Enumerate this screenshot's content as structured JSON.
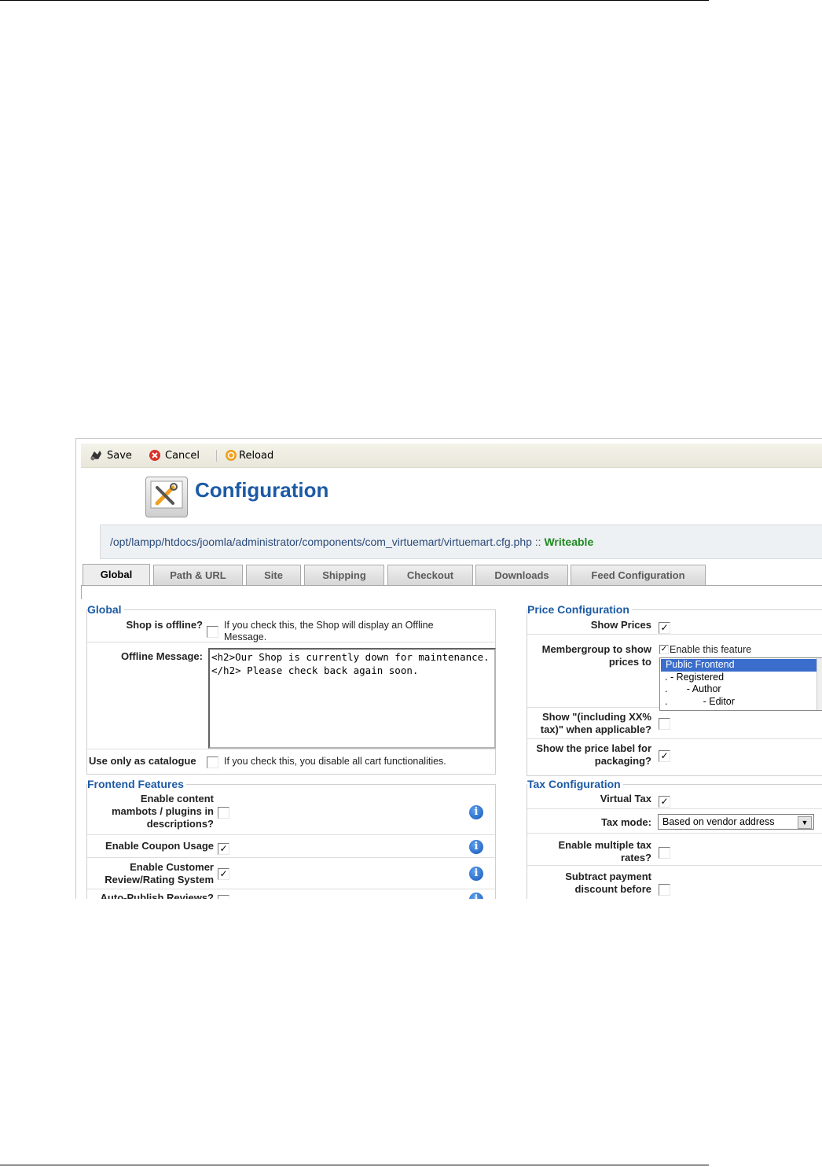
{
  "toolbar": {
    "save_label": "Save",
    "cancel_label": "Cancel",
    "reload_label": "Reload"
  },
  "header": {
    "title": "Configuration"
  },
  "config_file": {
    "path": "/opt/lampp/htdocs/joomla/administrator/components/com_virtuemart/virtuemart.cfg.php",
    "separator": "::",
    "status": "Writeable"
  },
  "tabs": [
    {
      "label": "Global"
    },
    {
      "label": "Path & URL"
    },
    {
      "label": "Site"
    },
    {
      "label": "Shipping"
    },
    {
      "label": "Checkout"
    },
    {
      "label": "Downloads"
    },
    {
      "label": "Feed Configuration"
    }
  ],
  "global": {
    "legend": "Global",
    "shop_offline": {
      "label": "Shop is offline?",
      "checked": false,
      "note": "If you check this, the Shop will display an Offline Message."
    },
    "offline_message": {
      "label": "Offline Message:",
      "value": "<h2>Our Shop is currently down for maintenance.</h2> Please check back again soon."
    },
    "catalogue": {
      "label": "Use only as catalogue",
      "checked": false,
      "note": "If you check this, you disable all cart functionalities."
    }
  },
  "frontend": {
    "legend": "Frontend Features",
    "items": [
      {
        "label": "Enable content mambots / plugins in descriptions?",
        "checked": false
      },
      {
        "label": "Enable Coupon Usage",
        "checked": true
      },
      {
        "label": "Enable Customer Review/Rating System",
        "checked": true
      },
      {
        "label": "Auto-Publish Reviews?",
        "checked": false
      }
    ]
  },
  "price": {
    "legend": "Price Configuration",
    "show_prices": {
      "label": "Show Prices",
      "checked": true
    },
    "membergroup": {
      "label": "Membergroup to show prices to",
      "enable_label": "Enable this feature",
      "enabled": true,
      "options": [
        "Public Frontend",
        ". - Registered",
        ".       - Author",
        ".             - Editor"
      ],
      "selected_index": 0
    },
    "including_tax": {
      "label": "Show \"(including XX% tax)\" when applicable?",
      "checked": false
    },
    "price_label": {
      "label": "Show the price label for packaging?",
      "checked": true
    }
  },
  "tax": {
    "legend": "Tax Configuration",
    "virtual_tax": {
      "label": "Virtual Tax",
      "checked": true
    },
    "tax_mode": {
      "label": "Tax mode:",
      "value": "Based on vendor address"
    },
    "multiple_rates": {
      "label": "Enable multiple tax rates?",
      "checked": false
    },
    "subtract_discount": {
      "label": "Subtract payment discount before",
      "checked": false
    }
  },
  "icons": {
    "save": "save-icon",
    "cancel": "cancel-icon",
    "reload": "reload-icon",
    "header": "tools-icon",
    "info": "info-icon"
  },
  "colors": {
    "heading_blue": "#1c5aa5",
    "status_green": "#1f8a1f",
    "selection_blue": "#3a6dcc"
  }
}
